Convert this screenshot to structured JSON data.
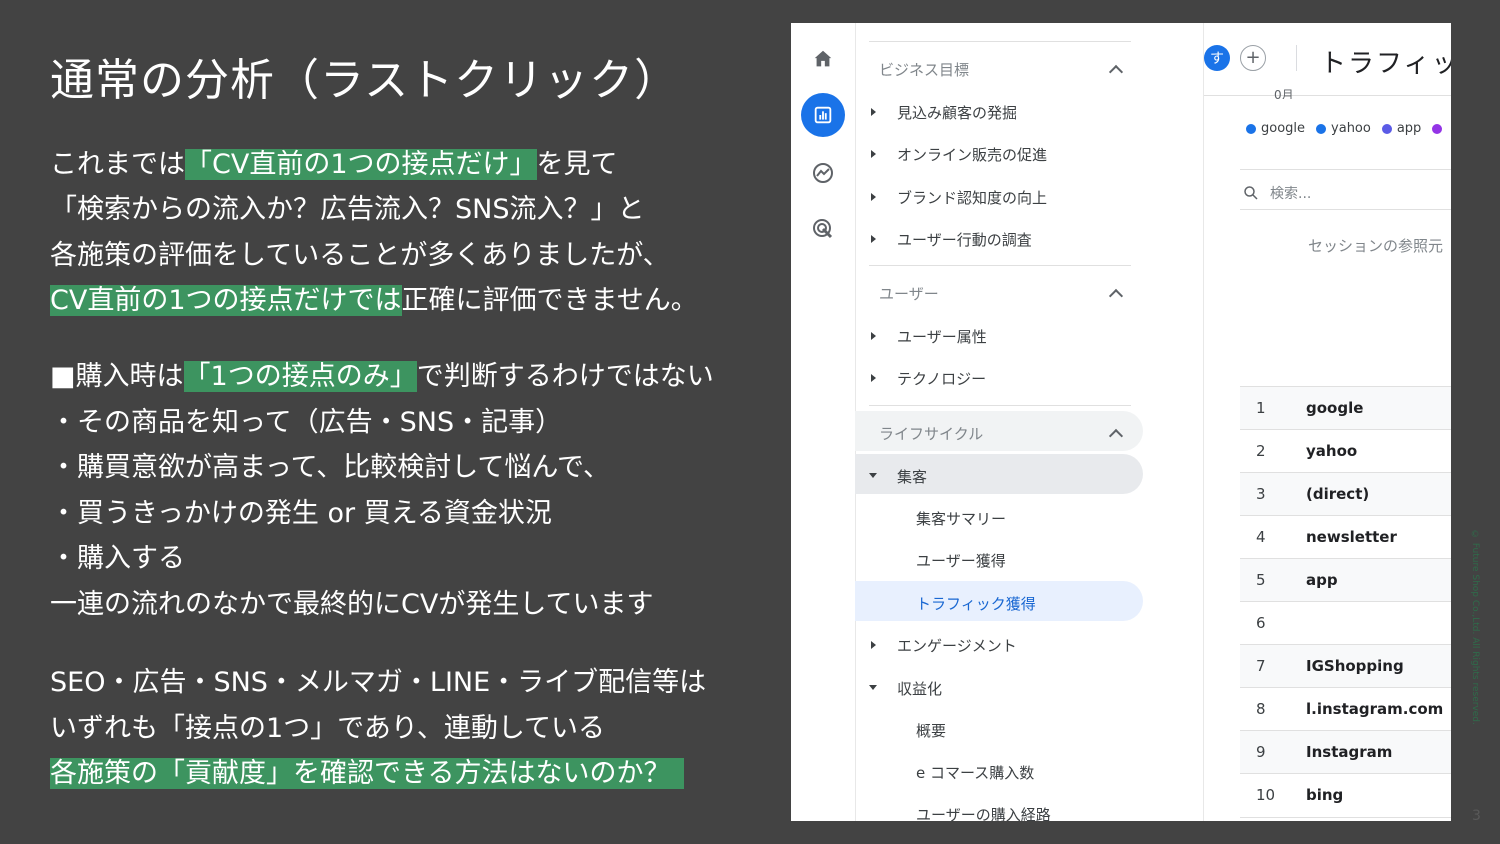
{
  "slide": {
    "title": "通常の分析（ラストクリック）",
    "para1": {
      "line1_pre": "これまでは",
      "line1_hl": "「CV直前の1つの接点だけ」",
      "line1_post": "を見て",
      "line2": "「検索からの流入か？広告流入？SNS流入？」と",
      "line3": "各施策の評価をしていることが多くありましたが、",
      "line4_hl": "CV直前の1つの接点だけでは",
      "line4_post": "正確に評価できません。"
    },
    "para2": {
      "line1_pre": "■購入時は",
      "line1_hl": "「1つの接点のみ」",
      "line1_post": "で判断するわけではない",
      "line2": "・その商品を知って（広告・SNS・記事）",
      "line3": "・購買意欲が高まって、比較検討して悩んで、",
      "line4": "・買うきっかけの発生 or 買える資金状況",
      "line5": "・購入する",
      "line6": "一連の流れのなかで最終的にCVが発生しています"
    },
    "para3": {
      "line1": "SEO・広告・SNS・メルマガ・LINE・ライブ配信等は",
      "line2": "いずれも「接点の1つ」であり、連動している",
      "line3_hl": "各施策の「貢献度」を確認できる方法はないのか？"
    },
    "copyright": "© Future Shop Co.,Ltd. All Rights reserved.",
    "page_number": "3",
    "highlight_color": "#3d9460"
  },
  "ga": {
    "nav": {
      "sections": [
        {
          "label": "ビジネス目標",
          "items": [
            "見込み顧客の発掘",
            "オンライン販売の促進",
            "ブランド認知度の向上",
            "ユーザー行動の調査"
          ]
        },
        {
          "label": "ユーザー",
          "items": [
            "ユーザー属性",
            "テクノロジー"
          ]
        },
        {
          "label": "ライフサイクル"
        }
      ],
      "acquisition": "集客",
      "acq_summary": "集客サマリー",
      "user_acq": "ユーザー獲得",
      "traffic_acq": "トラフィック獲得",
      "engagement": "エンゲージメント",
      "monetization": "収益化",
      "overview": "概要",
      "ecommerce": "e コマース購入数",
      "purchase_journey": "ユーザーの購入経路"
    },
    "header": {
      "avatar_initial": "す",
      "plus": "+",
      "title": "トラフィッ"
    },
    "legend": {
      "partial_label": "0月",
      "items": [
        {
          "label": "google",
          "color": "#1a73e8"
        },
        {
          "label": "yahoo",
          "color": "#1a73e8"
        },
        {
          "label": "app",
          "color": "#5b5be6"
        },
        {
          "label": "",
          "color": "#9334e6"
        }
      ]
    },
    "search_placeholder": "検索...",
    "column_header": "セッションの参照元",
    "rows": [
      {
        "num": "1",
        "name": "google"
      },
      {
        "num": "2",
        "name": "yahoo"
      },
      {
        "num": "3",
        "name": "(direct)"
      },
      {
        "num": "4",
        "name": "newsletter"
      },
      {
        "num": "5",
        "name": "app"
      },
      {
        "num": "6",
        "name": ""
      },
      {
        "num": "7",
        "name": "IGShopping"
      },
      {
        "num": "8",
        "name": "l.instagram.com"
      },
      {
        "num": "9",
        "name": "Instagram"
      },
      {
        "num": "10",
        "name": "bing"
      }
    ],
    "accent_color": "#1a73e8"
  }
}
